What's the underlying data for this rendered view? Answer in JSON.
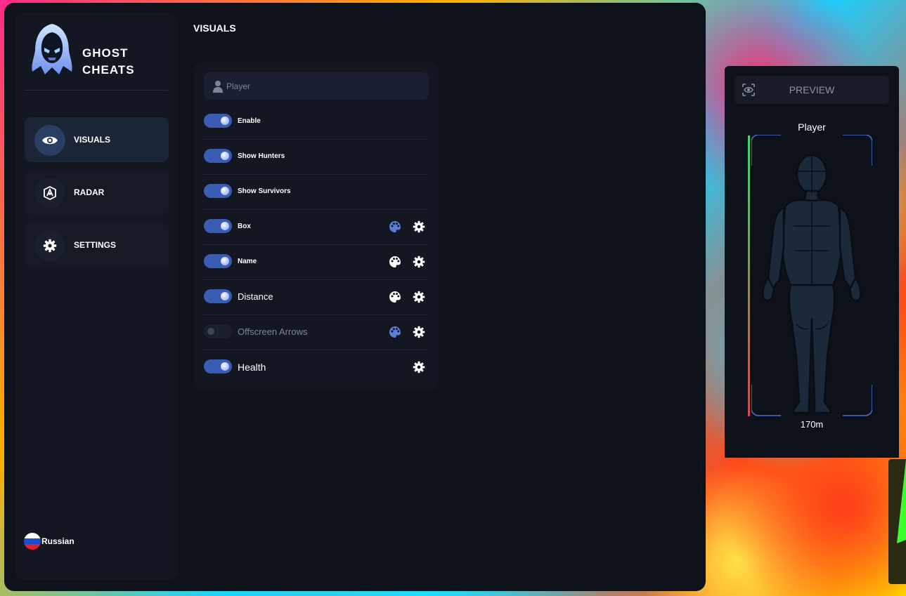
{
  "brand": {
    "line1": "GHOST",
    "line2": "CHEATS"
  },
  "sidebar": {
    "items": [
      {
        "label": "VISUALS",
        "icon": "eye-icon",
        "active": true
      },
      {
        "label": "RADAR",
        "icon": "radar-icon",
        "active": false
      },
      {
        "label": "SETTINGS",
        "icon": "gear-icon",
        "active": false
      }
    ],
    "language": {
      "label": "Russian",
      "icon": "russia-flag-icon"
    }
  },
  "main": {
    "section_title": "VISUALS",
    "panel": {
      "header_label": "Player",
      "rows": [
        {
          "label": "Enable",
          "enabled": true
        },
        {
          "label": "Show Hunters",
          "enabled": true
        },
        {
          "label": "Show Survivors",
          "enabled": true
        },
        {
          "label": "Box",
          "enabled": true,
          "palette": true,
          "settings": true
        },
        {
          "label": "Name",
          "enabled": true,
          "palette": true,
          "settings": true
        },
        {
          "label": "Distance",
          "enabled": true,
          "palette": true,
          "settings": true
        },
        {
          "label": "Offscreen Arrows",
          "enabled": false,
          "palette": true,
          "settings": true
        },
        {
          "label": "Health",
          "enabled": true,
          "palette": false,
          "settings": true
        }
      ]
    }
  },
  "preview": {
    "header_label": "PREVIEW",
    "player_label": "Player",
    "distance": "170m"
  },
  "colors": {
    "accent": "#3a5db3",
    "panel_bg": "#121722",
    "window_bg": "#0e121b",
    "palette_active": "#5b7fd6"
  }
}
